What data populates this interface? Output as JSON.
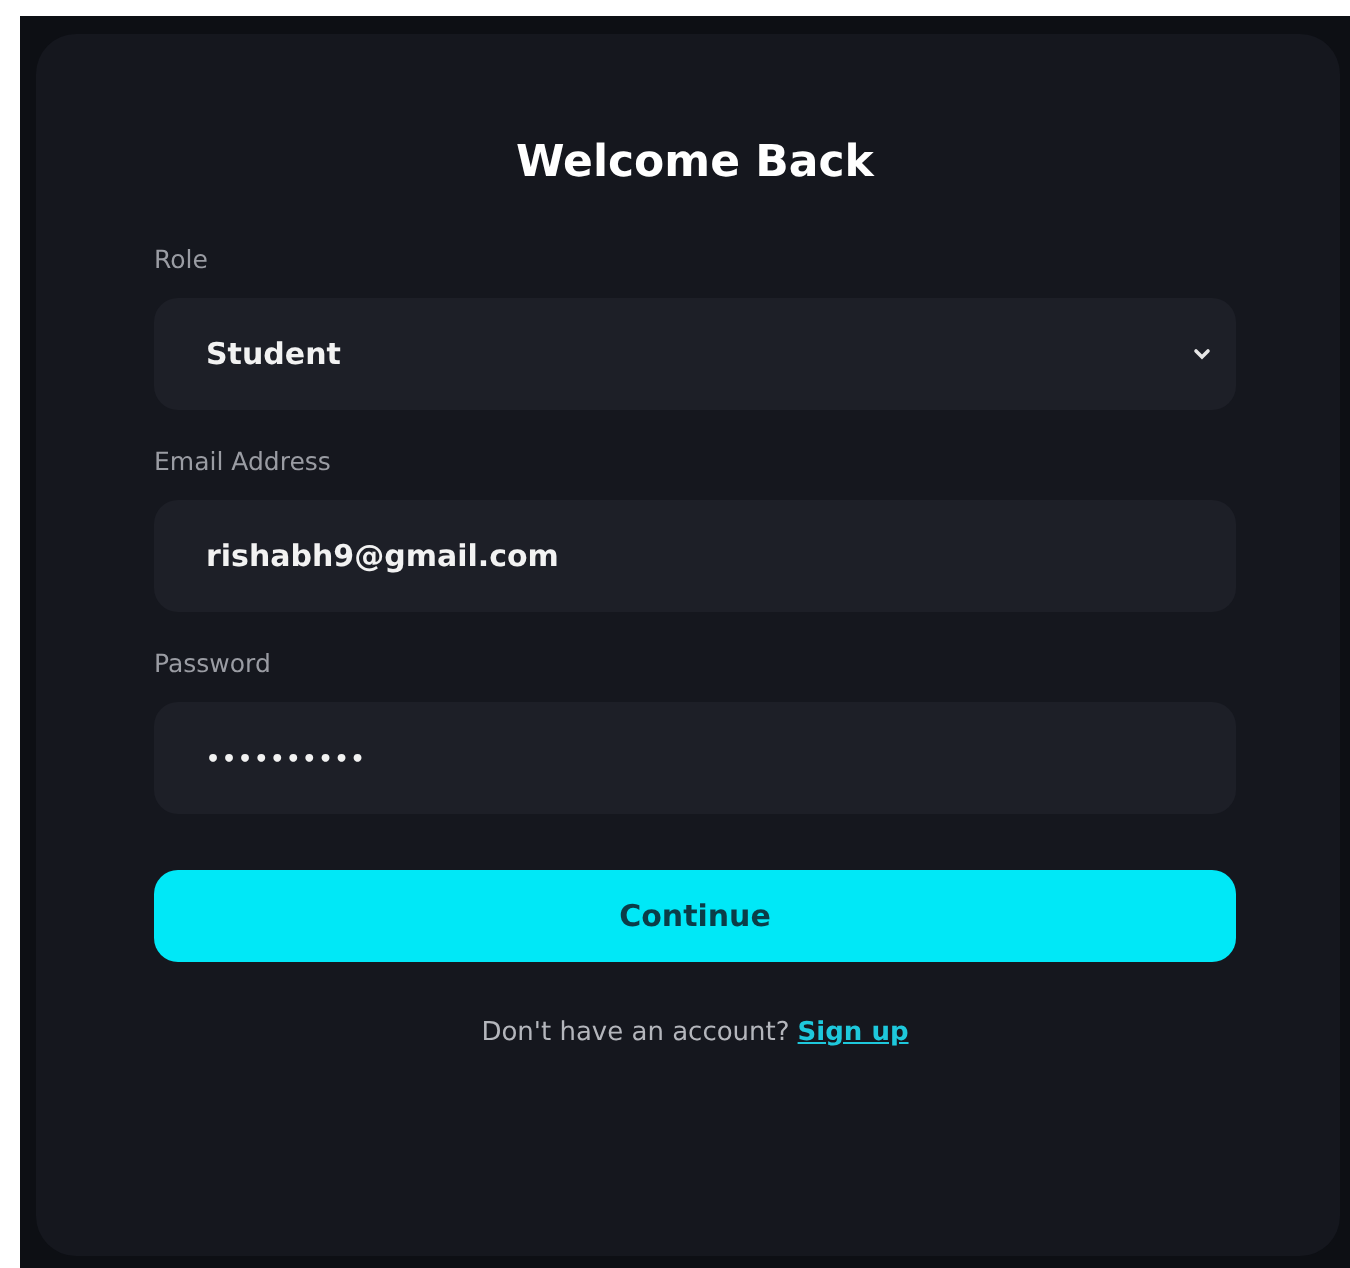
{
  "title": "Welcome Back",
  "fields": [
    {
      "kind": "select",
      "label": "Role",
      "value": "Student"
    },
    {
      "kind": "text",
      "label": "Email Address",
      "value": "rishabh9@gmail.com"
    },
    {
      "kind": "password",
      "label": "Password",
      "value": "••••••••••"
    }
  ],
  "submit": "Continue",
  "footer": {
    "text": "Don't have an account?",
    "link": "Sign up"
  }
}
